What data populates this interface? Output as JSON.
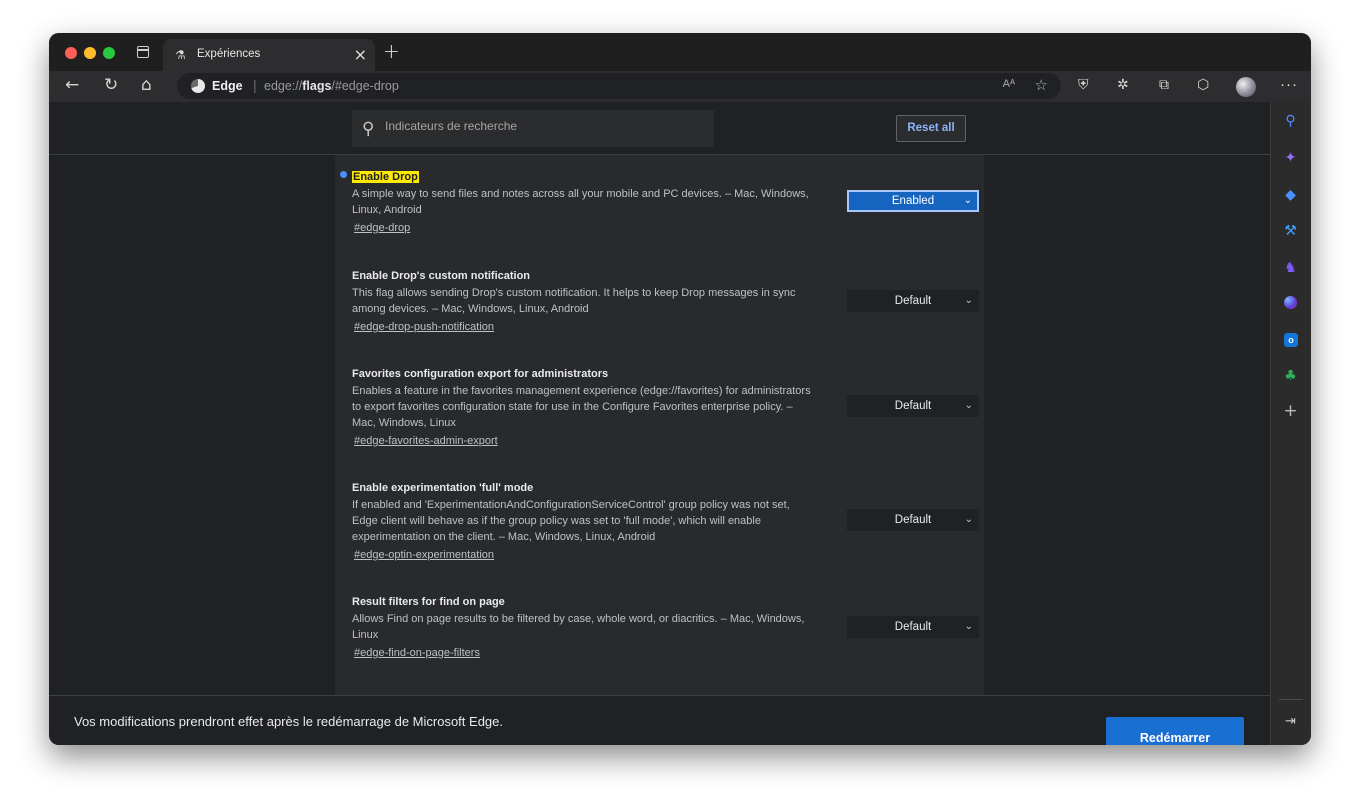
{
  "window": {
    "tab_title": "Expériences",
    "close_glyph": "×",
    "newtab_glyph": "+"
  },
  "toolbar": {
    "back_icon": "←",
    "refresh_icon": "↻",
    "home_icon": "⌂",
    "site_name": "Edge",
    "url_prefix": "edge://",
    "url_bold": "flags",
    "url_suffix": "/#edge-drop",
    "read_aloud": "Aᴬ",
    "favorite_icon": "☆",
    "more": "···"
  },
  "search": {
    "placeholder": "Indicateurs de recherche",
    "value": ""
  },
  "reset_label": "Reset all",
  "flags": [
    {
      "title": "Enable Drop",
      "highlighted": true,
      "description": "A simple way to send files and notes across all your mobile and PC devices. – Mac, Windows, Linux, Android",
      "link": "#edge-drop",
      "state": "Enabled"
    },
    {
      "title": "Enable Drop's custom notification",
      "highlighted": false,
      "description": "This flag allows sending Drop's custom notification. It helps to keep Drop messages in sync among devices. – Mac, Windows, Linux, Android",
      "link": "#edge-drop-push-notification",
      "state": "Default"
    },
    {
      "title": "Favorites configuration export for administrators",
      "highlighted": false,
      "description": "Enables a feature in the favorites management experience (edge://favorites) for administrators to export favorites configuration state for use in the Configure Favorites enterprise policy. – Mac, Windows, Linux",
      "link": "#edge-favorites-admin-export",
      "state": "Default"
    },
    {
      "title": "Enable experimentation 'full' mode",
      "highlighted": false,
      "description": "If enabled and 'ExperimentationAndConfigurationServiceControl' group policy was not set, Edge client will behave as if the group policy was set to 'full mode', which will enable experimentation on the client. – Mac, Windows, Linux, Android",
      "link": "#edge-optin-experimentation",
      "state": "Default"
    },
    {
      "title": "Result filters for find on page",
      "highlighted": false,
      "description": "Allows Find on page results to be filtered by case, whole word, or diacritics. – Mac, Windows, Linux",
      "link": "#edge-find-on-page-filters",
      "state": "Default"
    }
  ],
  "notice": {
    "message": "Vos modifications prendront effet après le redémarrage de Microsoft Edge.",
    "restart_label": "Redémarrer"
  },
  "sidebar": {
    "add_glyph": "+",
    "outlook_letter": "o"
  },
  "colors": {
    "accent": "#1a6fd3",
    "highlight": "#ffeb00",
    "link_blue": "#8ab4f8"
  }
}
